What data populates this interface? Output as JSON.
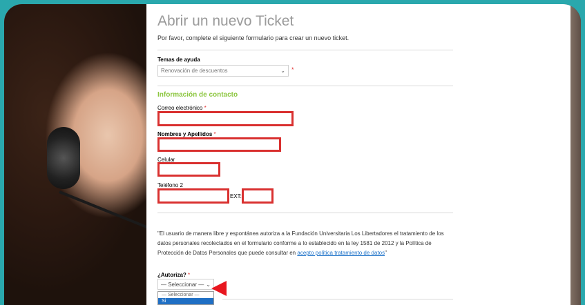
{
  "page": {
    "title": "Abrir un nuevo Ticket",
    "intro": "Por favor, complete el siguiente formulario para crear un nuevo ticket."
  },
  "help_topics": {
    "label": "Temas de ayuda",
    "selected": "Renovación de descuentos",
    "required_mark": "*"
  },
  "contact": {
    "section_title": "Información de contacto",
    "email_label": "Correo electrónico",
    "name_label": "Nombres y Apellidos",
    "phone_label": "Celular",
    "phone2_label": "Teléfono 2",
    "ext_label": "EXT:",
    "required_mark": "*"
  },
  "consent": {
    "text": "\"El usuario de manera libre y espontánea autoriza a la Fundación Universitaria Los Libertadores el tratamiento de los datos personales recolectados en el formulario conforme a lo establecido en la ley 1581 de 2012 y la Política de Protección de Datos Personales que puede consultar en",
    "link_text": "acepto política tratamiento de datos",
    "closing": "\"",
    "authorize_label": "¿Autoriza?",
    "required_mark": "*",
    "select_value": "— Seleccionar —",
    "options": [
      "— Seleccionar —",
      "Si"
    ]
  },
  "colors": {
    "background": "#2aa8ad",
    "section_title": "#8cc63f",
    "highlight_border": "#d9302f",
    "arrow": "#e8161f",
    "link": "#1f73c9"
  }
}
